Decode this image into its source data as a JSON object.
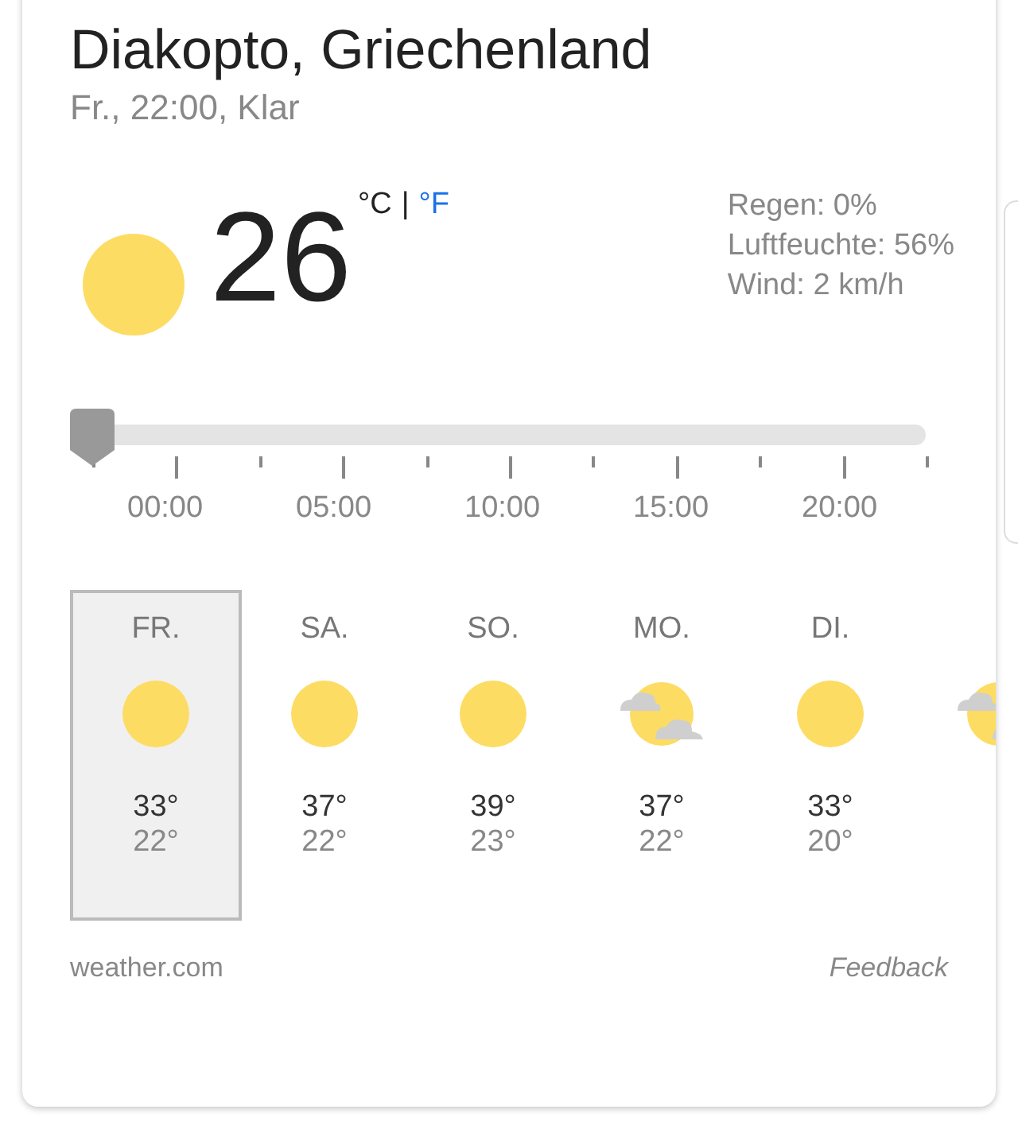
{
  "location": "Diakopto, Griechenland",
  "subtitle": "Fr., 22:00, Klar",
  "current": {
    "kind": "sun",
    "temperature": "26",
    "unit_celsius": "°C",
    "unit_separator": "|",
    "unit_fahrenheit": "°F"
  },
  "details": [
    "Regen: 0%",
    "Luftfeuchte: 56%",
    "Wind: 2 km/h"
  ],
  "timeline": {
    "level": 0,
    "labels": [
      "00:00",
      "05:00",
      "10:00",
      "15:00",
      "20:00"
    ]
  },
  "days": [
    {
      "name": "FR.",
      "kind": "sun",
      "high": "33°",
      "low": "22°",
      "selected": true
    },
    {
      "name": "SA.",
      "kind": "sun",
      "high": "37°",
      "low": "22°",
      "selected": false
    },
    {
      "name": "SO.",
      "kind": "sun",
      "high": "39°",
      "low": "23°",
      "selected": false
    },
    {
      "name": "MO.",
      "kind": "partly-cloudy",
      "high": "37°",
      "low": "22°",
      "selected": false
    },
    {
      "name": "DI.",
      "kind": "sun",
      "high": "33°",
      "low": "20°",
      "selected": false
    },
    {
      "kind": "partly-cloudy",
      "selected": false
    }
  ],
  "footer": {
    "source": "weather.com",
    "feedback": "Feedback"
  }
}
